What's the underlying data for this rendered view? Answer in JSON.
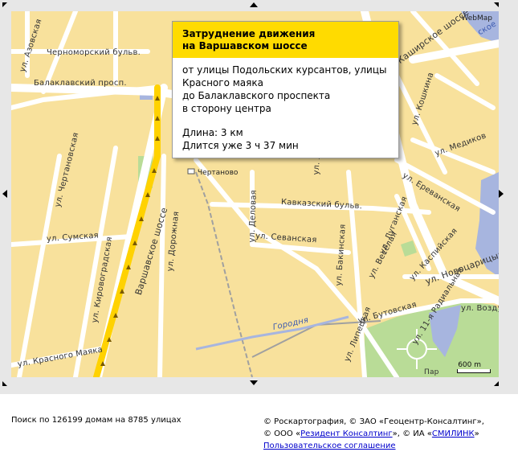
{
  "map": {
    "provider_logo": "WebMap",
    "scale_text": "600 m",
    "colors": {
      "land": "#f8e19c",
      "road": "#ffffff",
      "road_edge": "#c9b88a",
      "water": "#a7b5df",
      "park": "#b9dc97",
      "jam_line": "#ffd200",
      "railway": "#a0a0a0"
    },
    "street_labels": {
      "azovskaya": "ул. Азовская",
      "chernomorsky": "Черноморский бульв.",
      "balaklavsky": "Балаклавский просп.",
      "chertanovskaya": "ул. Чертановская",
      "varshavskoe": "Варшавское шоссе",
      "dorozhnaya": "ул. Дорожная",
      "sumskaya": "ул. Сумская",
      "kirovogradskaya": "ул. Кировоградская",
      "krasnogo_mayaka": "ул. Красного Маяка",
      "delovaya": "ул. Деловая",
      "kavkazsky": "Кавказский бульв.",
      "sevanskaya": "ул. Севанская",
      "bakinskaya": "ул. Бакинская",
      "lugansk": "ул. Луганская",
      "veselaya": "ул. Весёлая",
      "kashirskoe": "Каширское шоссе",
      "koshkina": "ул. Кошкина",
      "medikov": "ул. Медиков",
      "erevanskaya": "ул. Ереванская",
      "kaspiyskaya": "ул. Каспийская",
      "novotsaritsyn": "ул. Новоцарицынское",
      "vozdush": "ул. Возду",
      "butovskaya": "ул. Бутовская",
      "radialnaya": "ул. 11-я Радиальная",
      "lipetskaya": "ул. Липецкая",
      "gorodnya": "Городня",
      "lenin_partial": "ул. Ле",
      "park_partial": "Пар",
      "kashirskoe_partial": "ское"
    },
    "station_label": "Чертаново"
  },
  "popup": {
    "title_line1": "Затруднение движения",
    "title_line2": "на Варшавском шоссе",
    "body_line1": "от улицы Подольских курсантов, улицы",
    "body_line2": "Красного маяка",
    "body_line3": "до Балаклавского проспекта",
    "body_line4": "в сторону центра",
    "length": "Длина: 3 км",
    "duration": "Длится уже 3 ч 37 мин"
  },
  "footer": {
    "search_stats": "Поиск по 126199 домам на 8785 улицах",
    "copyright_line1": "© Роскартография, © ЗАО «Геоцентр-Консалтинг»,",
    "copyright_ooo_prefix": "© ООО «",
    "rezident_link": "Резидент Консалтинг",
    "copyright_ia_prefix": "», © ИА «",
    "smilink_link": "СМИЛИНК",
    "copyright_end": "»",
    "agreement_link": "Пользовательское соглашение"
  }
}
